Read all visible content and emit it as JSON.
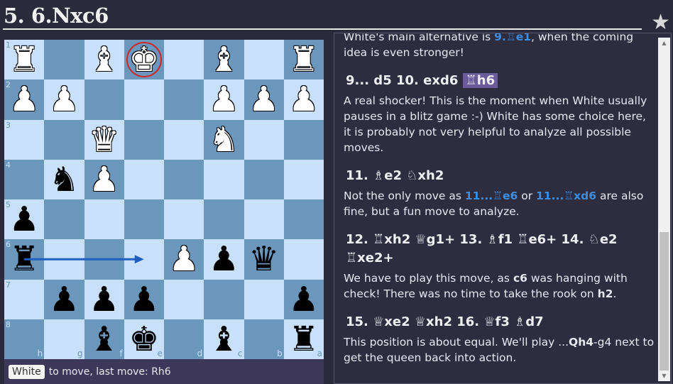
{
  "title": "5. 6.Nxc6",
  "star_icon": "star-icon",
  "colors": {
    "light_square": "#c9e0fb",
    "dark_square": "#6b97bd",
    "highlight": "#6b5b9a",
    "link": "#3d8ee0",
    "check": "#d42525",
    "arrow": "#1f5fc4"
  },
  "board": {
    "files_display": [
      "h",
      "g",
      "f",
      "e",
      "d",
      "c",
      "b",
      "a"
    ],
    "ranks_display": [
      "1",
      "2",
      "3",
      "4",
      "5",
      "6",
      "7",
      "8"
    ],
    "rows": [
      [
        "wR",
        "",
        "wB",
        "wK",
        "",
        "wB",
        "",
        "wR"
      ],
      [
        "wP",
        "wP",
        "",
        "",
        "",
        "wP",
        "wP",
        "wP"
      ],
      [
        "",
        "",
        "wQ",
        "",
        "",
        "wN",
        "",
        ""
      ],
      [
        "",
        "bN",
        "wP",
        "",
        "",
        "",
        "",
        ""
      ],
      [
        "bP",
        "",
        "",
        "",
        "",
        "",
        "",
        ""
      ],
      [
        "bR",
        "",
        "",
        "",
        "wP",
        "bP",
        "bQ",
        ""
      ],
      [
        "",
        "bP",
        "bP",
        "bP",
        "",
        "",
        "",
        "bP"
      ],
      [
        "",
        "",
        "bB",
        "bK",
        "",
        "bB",
        "",
        "bR"
      ]
    ],
    "check_square": "e1",
    "arrow": {
      "from": "h6",
      "to": "e6"
    }
  },
  "status": {
    "side": "White",
    "text": "to move, last move: Rh6"
  },
  "notes": [
    {
      "type": "p",
      "segs": [
        {
          "t": "White's main alternative is "
        },
        {
          "t": "9.♖e1",
          "c": "lnk"
        },
        {
          "t": ", when the coming idea is even stronger!"
        }
      ]
    },
    {
      "type": "mv",
      "segs": [
        {
          "t": "9... d5  10. exd6 "
        },
        {
          "t": "♖h6",
          "c": "hl"
        }
      ]
    },
    {
      "type": "p",
      "segs": [
        {
          "t": "A real shocker! This is the moment when White usually pauses in a blitz game :-) White has some choice here, it is probably not very helpful to analyze all possible moves."
        }
      ]
    },
    {
      "type": "mv",
      "segs": [
        {
          "t": "11. ♗e2  ♘xh2"
        }
      ]
    },
    {
      "type": "p",
      "segs": [
        {
          "t": "Not the only move as "
        },
        {
          "t": "11...♖e6",
          "c": "lnk"
        },
        {
          "t": " or "
        },
        {
          "t": "11...♖xd6",
          "c": "lnk"
        },
        {
          "t": " are also fine, but a fun move to analyze."
        }
      ]
    },
    {
      "type": "mv",
      "segs": [
        {
          "t": "12. ♖xh2  ♕g1+ 13. ♗f1  ♖e6+ 14. ♘e2  ♖xe2+"
        }
      ]
    },
    {
      "type": "p",
      "segs": [
        {
          "t": "We have to play this move, as "
        },
        {
          "t": "c6",
          "c": "b"
        },
        {
          "t": " was hanging with check! There was no time to take the rook on "
        },
        {
          "t": "h2",
          "c": "b"
        },
        {
          "t": "."
        }
      ]
    },
    {
      "type": "mv",
      "segs": [
        {
          "t": "15. ♕xe2  ♕xh2 16. ♕f3  ♗d7"
        }
      ]
    },
    {
      "type": "p",
      "segs": [
        {
          "t": "This position is about equal. We'll play ..."
        },
        {
          "t": "Qh4",
          "c": "b"
        },
        {
          "t": "-g4 next to get the queen back into action."
        }
      ]
    }
  ]
}
